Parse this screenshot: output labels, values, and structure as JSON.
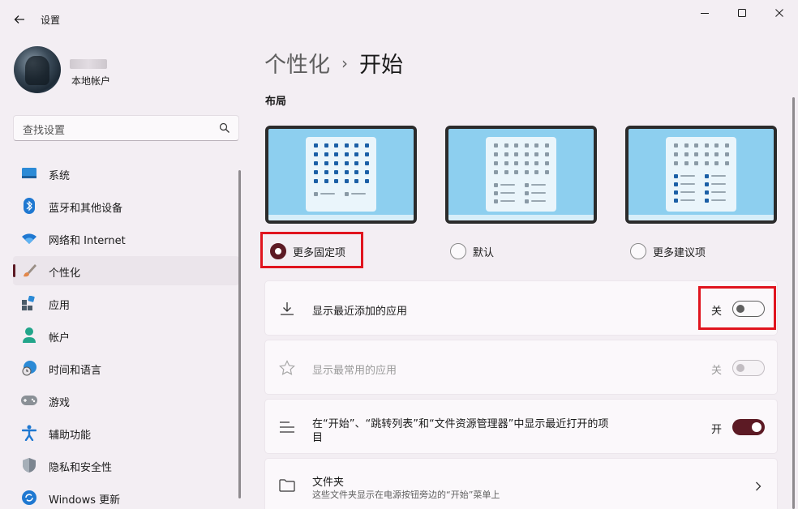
{
  "app": {
    "title": "设置"
  },
  "user": {
    "account_type": "本地帐户"
  },
  "search": {
    "placeholder": "查找设置"
  },
  "sidebar": {
    "items": [
      {
        "label": "系统",
        "icon": "system-icon"
      },
      {
        "label": "蓝牙和其他设备",
        "icon": "bluetooth-icon"
      },
      {
        "label": "网络和 Internet",
        "icon": "wifi-icon"
      },
      {
        "label": "个性化",
        "icon": "brush-icon",
        "active": true
      },
      {
        "label": "应用",
        "icon": "apps-icon"
      },
      {
        "label": "帐户",
        "icon": "person-icon"
      },
      {
        "label": "时间和语言",
        "icon": "globe-clock-icon"
      },
      {
        "label": "游戏",
        "icon": "gamepad-icon"
      },
      {
        "label": "辅助功能",
        "icon": "accessibility-icon"
      },
      {
        "label": "隐私和安全性",
        "icon": "shield-icon"
      },
      {
        "label": "Windows 更新",
        "icon": "update-icon"
      }
    ]
  },
  "breadcrumb": {
    "parent": "个性化",
    "separator": "›",
    "current": "开始"
  },
  "layout": {
    "title": "布局",
    "options": [
      {
        "label": "更多固定项",
        "checked": true
      },
      {
        "label": "默认",
        "checked": false
      },
      {
        "label": "更多建议项",
        "checked": false
      }
    ]
  },
  "settings": {
    "recent_apps": {
      "label": "显示最近添加的应用",
      "state_text": "关",
      "on": false
    },
    "most_used": {
      "label": "显示最常用的应用",
      "state_text": "关",
      "on": false,
      "disabled": true
    },
    "recent_items": {
      "label_line1": "在“开始”、“跳转列表”和“文件资源管理器”中显示最近打开的项",
      "label_line2": "目",
      "state_text": "开",
      "on": true
    },
    "folders": {
      "label": "文件夹",
      "sub": "这些文件夹显示在电源按钮旁边的“开始”菜单上"
    }
  },
  "colors": {
    "accent": "#5c1a24",
    "highlight": "#e0141e",
    "background": "#f3eef3"
  }
}
